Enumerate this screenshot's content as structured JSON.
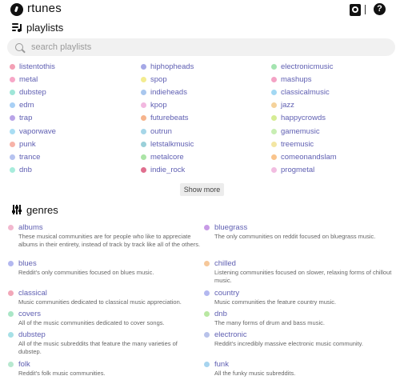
{
  "app": {
    "title": "rtunes"
  },
  "header": {
    "github_icon": "github-icon",
    "help_icon": "help-icon",
    "help_glyph": "?"
  },
  "playlists": {
    "heading": "playlists",
    "search_placeholder": "search playlists",
    "show_more_label": "Show more",
    "items": [
      {
        "label": "listentothis",
        "color": "#f3a0b5"
      },
      {
        "label": "hiphopheads",
        "color": "#a5a8e6"
      },
      {
        "label": "electronicmusic",
        "color": "#a4e4b0"
      },
      {
        "label": "metal",
        "color": "#f7a7c7"
      },
      {
        "label": "spop",
        "color": "#f3ec90"
      },
      {
        "label": "mashups",
        "color": "#f4a3c5"
      },
      {
        "label": "dubstep",
        "color": "#9fe6d8"
      },
      {
        "label": "indieheads",
        "color": "#a9c7ee"
      },
      {
        "label": "classicalmusic",
        "color": "#a3d8f3"
      },
      {
        "label": "edm",
        "color": "#a8d0f5"
      },
      {
        "label": "kpop",
        "color": "#f2b8e0"
      },
      {
        "label": "jazz",
        "color": "#f5d29b"
      },
      {
        "label": "trap",
        "color": "#b9a4e8"
      },
      {
        "label": "futurebeats",
        "color": "#f6b48d"
      },
      {
        "label": "happycrowds",
        "color": "#d5ec94"
      },
      {
        "label": "vaporwave",
        "color": "#a9ddf3"
      },
      {
        "label": "outrun",
        "color": "#a6d6e8"
      },
      {
        "label": "gamemusic",
        "color": "#c8eeb3"
      },
      {
        "label": "punk",
        "color": "#f7b3a8"
      },
      {
        "label": "letstalkmusic",
        "color": "#9ad0d9"
      },
      {
        "label": "treemusic",
        "color": "#f3e6a3"
      },
      {
        "label": "trance",
        "color": "#b6c3f0"
      },
      {
        "label": "metalcore",
        "color": "#abe4a6"
      },
      {
        "label": "comeonandslam",
        "color": "#f9c48c"
      },
      {
        "label": "dnb",
        "color": "#a7ecdc"
      },
      {
        "label": "indie_rock",
        "color": "#e06f8f"
      },
      {
        "label": "progmetal",
        "color": "#f2bde1"
      }
    ]
  },
  "genres": {
    "heading": "genres",
    "items": [
      {
        "name": "albums",
        "color": "#f2b8cf",
        "desc": "These musical communities are for people who like to appreciate albums in their entirety, instead of track by track like all of the others."
      },
      {
        "name": "bluegrass",
        "color": "#c89be6",
        "desc": "The only communities on reddit focused on bluegrass music."
      },
      {
        "name": "blues",
        "color": "#b3b8f0",
        "desc": "Reddit's only communities focused on blues music."
      },
      {
        "name": "chilled",
        "color": "#f6c89a",
        "desc": "Listening communities focused on slower, relaxing forms of chillout music."
      },
      {
        "name": "classical",
        "color": "#f2a7b8",
        "desc": "Music communities dedicated to classical music appreciation."
      },
      {
        "name": "country",
        "color": "#b3b8f0",
        "desc": "Music communities the feature country music."
      },
      {
        "name": "covers",
        "color": "#a9e6c6",
        "desc": "All of the music communities dedicated to cover songs."
      },
      {
        "name": "dnb",
        "color": "#b9e8a2",
        "desc": "The many forms of drum and bass music."
      },
      {
        "name": "dubstep",
        "color": "#a6e0e6",
        "desc": "All of the music subreddits that feature the many varieties of dubstep."
      },
      {
        "name": "electronic",
        "color": "#b8c2ea",
        "desc": "Reddit's incredibly massive electronic music community."
      },
      {
        "name": "folk",
        "color": "#b7e8cf",
        "desc": "Reddit's folk music communities."
      },
      {
        "name": "funk",
        "color": "#a7d4ef",
        "desc": "All the funky music subreddits."
      }
    ]
  }
}
